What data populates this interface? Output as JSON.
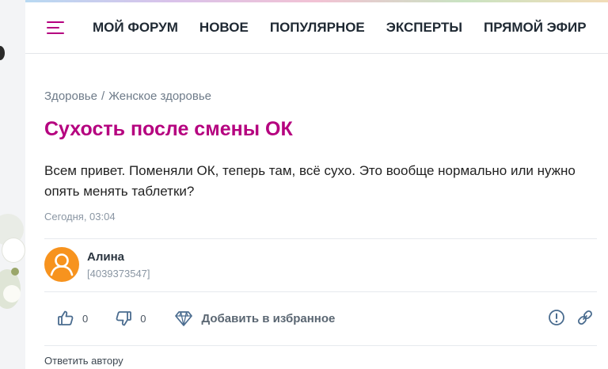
{
  "nav": {
    "items": [
      {
        "label": "МОЙ ФОРУМ"
      },
      {
        "label": "НОВОЕ"
      },
      {
        "label": "ПОПУЛЯРНОЕ"
      },
      {
        "label": "ЭКСПЕРТЫ"
      },
      {
        "label": "ПРЯМОЙ ЭФИР"
      }
    ]
  },
  "breadcrumb": {
    "items": [
      "Здоровье",
      "Женское здоровье"
    ],
    "separator": "/"
  },
  "post": {
    "title": "Сухость после смены ОК",
    "body": "Всем привет. Поменяли ОК, теперь там, всё сухо. Это вообще нормально или нужно опять менять таблетки?",
    "time": "Сегодня, 03:04"
  },
  "author": {
    "name": "Алина",
    "id": "[4039373547]"
  },
  "actions": {
    "likes": "0",
    "dislikes": "0",
    "favorite_label": "Добавить в избранное",
    "reply_label": "Ответить автору"
  },
  "colors": {
    "accent": "#b5007f",
    "avatar": "#f7931e",
    "icon": "#4a6c8f"
  }
}
